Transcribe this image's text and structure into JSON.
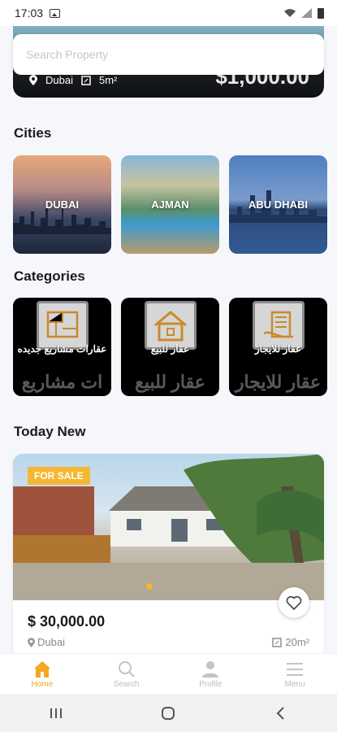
{
  "status_bar": {
    "time": "17:03"
  },
  "hero": {
    "location": "Dubai",
    "area": "5m²",
    "price": "$1,000.00"
  },
  "search": {
    "placeholder": "Search Property"
  },
  "sections": {
    "cities": "Cities",
    "categories": "Categories",
    "today_new": "Today New"
  },
  "cities": [
    {
      "name": "DUBAI"
    },
    {
      "name": "AJMAN"
    },
    {
      "name": "ABU DHABI"
    }
  ],
  "categories": [
    {
      "label": "عقارات مشاريع جديده",
      "watermark": "ات مشاريع"
    },
    {
      "label": "عقار للبيع",
      "watermark": "عقار للبيع"
    },
    {
      "label": "عقار للايجار",
      "watermark": "عقار للايجار"
    }
  ],
  "listing": {
    "badge": "FOR SALE",
    "price": "$ 30,000.00",
    "location": "Dubai",
    "area": "20m²"
  },
  "bottom_nav": [
    {
      "label": "Home",
      "icon": "home-icon",
      "active": true
    },
    {
      "label": "Search",
      "icon": "search-icon",
      "active": false
    },
    {
      "label": "Profile",
      "icon": "profile-icon",
      "active": false
    },
    {
      "label": "Menu",
      "icon": "menu-icon",
      "active": false
    }
  ],
  "colors": {
    "accent": "#f5a623",
    "badge": "#f5b731",
    "background": "#f6f7fb"
  }
}
